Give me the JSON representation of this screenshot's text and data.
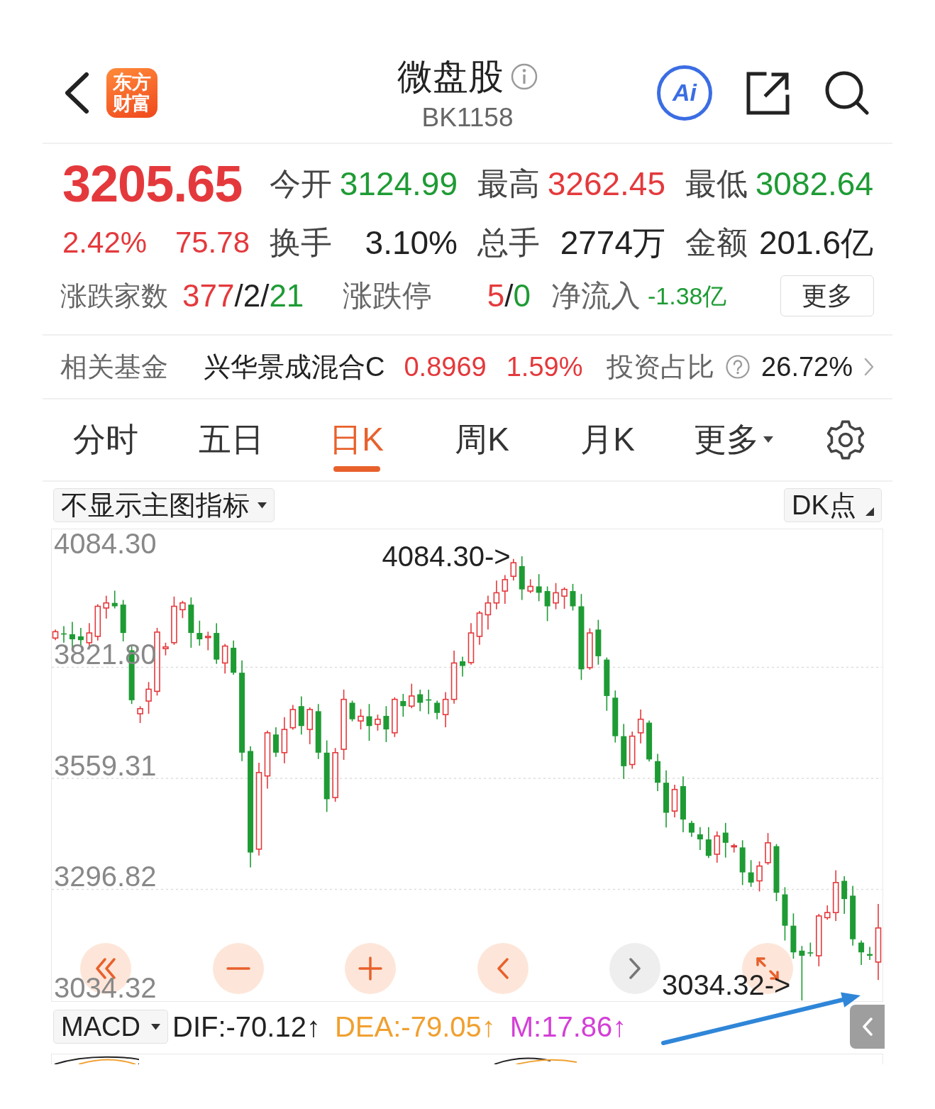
{
  "header": {
    "logo": [
      "东方",
      "财富"
    ],
    "title": "微盘股",
    "code": "BK1158",
    "ai_label": "Ai"
  },
  "quote": {
    "price": "3205.65",
    "change_percent": "2.42%",
    "change": "75.78",
    "rising": true,
    "stats": [
      {
        "label": "今开",
        "value": "3124.99",
        "color": "#1e9b34"
      },
      {
        "label": "最高",
        "value": "3262.45",
        "color": "#e4393c"
      },
      {
        "label": "最低",
        "value": "3082.64",
        "color": "#1e9b34"
      },
      {
        "label": "换手",
        "value": "3.10%",
        "color": "#222222"
      },
      {
        "label": "总手",
        "value": "2774万",
        "color": "#222222"
      },
      {
        "label": "金额",
        "value": "201.6亿",
        "color": "#222222"
      }
    ],
    "advance_decline": {
      "label": "涨跌家数",
      "parts": [
        {
          "text": "377",
          "color": "#e4393c"
        },
        {
          "text": "/",
          "color": "#222222"
        },
        {
          "text": "2",
          "color": "#222222"
        },
        {
          "text": "/",
          "color": "#222222"
        },
        {
          "text": "21",
          "color": "#1e9b34"
        }
      ]
    },
    "limit_up_down": {
      "label": "涨跌停",
      "parts": [
        {
          "text": "5",
          "color": "#e4393c"
        },
        {
          "text": "/",
          "color": "#222222"
        },
        {
          "text": "0",
          "color": "#1e9b34"
        }
      ]
    },
    "net_inflow": {
      "label": "净流入",
      "value": "-1.38亿",
      "rising": false
    },
    "more_button": "更多"
  },
  "related_fund": {
    "label": "相关基金",
    "name": "兴华景成混合C",
    "nav": "0.8969",
    "change": "1.59%",
    "rising": true,
    "ratio_label": "投资占比",
    "ratio": "26.72%"
  },
  "tabs": [
    {
      "label": "分时",
      "selected": false,
      "kind": "plain"
    },
    {
      "label": "五日",
      "selected": false,
      "kind": "plain"
    },
    {
      "label": "日K",
      "selected": true,
      "kind": "plain"
    },
    {
      "label": "周K",
      "selected": false,
      "kind": "plain"
    },
    {
      "label": "月K",
      "selected": false,
      "kind": "plain"
    },
    {
      "label": "更多",
      "selected": false,
      "kind": "menu"
    }
  ],
  "chart": {
    "indicator_select": "不显示主图指标",
    "dk_button": "DK点",
    "chart_data": {
      "type": "candlestick",
      "ylim": [
        3034.32,
        4148
      ],
      "grid": true,
      "yticks": [
        {
          "value": 4084.3,
          "label": "4084.30"
        },
        {
          "value": 3821.8,
          "label": "3821.80"
        },
        {
          "value": 3559.31,
          "label": "3559.31"
        },
        {
          "value": 3296.82,
          "label": "3296.82"
        },
        {
          "value": 3034.32,
          "label": "3034.32"
        }
      ],
      "ohlc": [
        [
          3891,
          3911,
          3886,
          3906
        ],
        [
          3902,
          3919,
          3880,
          3900
        ],
        [
          3900,
          3929,
          3866,
          3888
        ],
        [
          3895,
          3915,
          3872,
          3886
        ],
        [
          3880,
          3926,
          3868,
          3903
        ],
        [
          3895,
          3971,
          3885,
          3966
        ],
        [
          3962,
          3991,
          3937,
          3974
        ],
        [
          3974,
          4003,
          3961,
          3966
        ],
        [
          3970,
          3981,
          3883,
          3903
        ],
        [
          3862,
          3875,
          3735,
          3744
        ],
        [
          3712,
          3730,
          3690,
          3724
        ],
        [
          3742,
          3787,
          3712,
          3770
        ],
        [
          3765,
          3915,
          3755,
          3905
        ],
        [
          3866,
          3880,
          3850,
          3870
        ],
        [
          3880,
          3989,
          3875,
          3966
        ],
        [
          3958,
          3979,
          3938,
          3974
        ],
        [
          3970,
          3987,
          3868,
          3903
        ],
        [
          3903,
          3932,
          3873,
          3888
        ],
        [
          3892,
          3906,
          3862,
          3895
        ],
        [
          3903,
          3926,
          3830,
          3840
        ],
        [
          3832,
          3877,
          3807,
          3872
        ],
        [
          3868,
          3885,
          3804,
          3809
        ],
        [
          3809,
          3838,
          3600,
          3620
        ],
        [
          3624,
          3635,
          3349,
          3384
        ],
        [
          3392,
          3596,
          3377,
          3573
        ],
        [
          3565,
          3672,
          3535,
          3667
        ],
        [
          3663,
          3680,
          3610,
          3620
        ],
        [
          3620,
          3704,
          3595,
          3675
        ],
        [
          3679,
          3733,
          3674,
          3722
        ],
        [
          3730,
          3753,
          3663,
          3683
        ],
        [
          3675,
          3727,
          3640,
          3722
        ],
        [
          3718,
          3735,
          3605,
          3620
        ],
        [
          3620,
          3649,
          3480,
          3510
        ],
        [
          3514,
          3631,
          3504,
          3620
        ],
        [
          3628,
          3769,
          3603,
          3746
        ],
        [
          3738,
          3743,
          3694,
          3699
        ],
        [
          3695,
          3723,
          3675,
          3706
        ],
        [
          3706,
          3735,
          3648,
          3683
        ],
        [
          3687,
          3710,
          3672,
          3699
        ],
        [
          3707,
          3730,
          3645,
          3675
        ],
        [
          3667,
          3751,
          3657,
          3746
        ],
        [
          3742,
          3759,
          3705,
          3730
        ],
        [
          3730,
          3783,
          3725,
          3754
        ],
        [
          3758,
          3769,
          3718,
          3738
        ],
        [
          3746,
          3769,
          3711,
          3746
        ],
        [
          3738,
          3743,
          3699,
          3714
        ],
        [
          3710,
          3763,
          3680,
          3746
        ],
        [
          3746,
          3861,
          3736,
          3832
        ],
        [
          3836,
          3847,
          3800,
          3825
        ],
        [
          3833,
          3926,
          3828,
          3903
        ],
        [
          3895,
          3955,
          3875,
          3950
        ],
        [
          3946,
          3991,
          3911,
          3974
        ],
        [
          3974,
          4027,
          3959,
          3998
        ],
        [
          4002,
          4040,
          3972,
          4029
        ],
        [
          4037,
          4078,
          4027,
          4069
        ],
        [
          4061,
          4084.3,
          3981,
          4006
        ],
        [
          4002,
          4030,
          3997,
          4013
        ],
        [
          4013,
          4042,
          3978,
          3998
        ],
        [
          4002,
          4013,
          3931,
          3966
        ],
        [
          3974,
          4021,
          3959,
          3998
        ],
        [
          3990,
          4011,
          3960,
          4006
        ],
        [
          4002,
          4019,
          3956,
          3966
        ],
        [
          3966,
          3995,
          3792,
          3817
        ],
        [
          3821,
          3914,
          3816,
          3903
        ],
        [
          3911,
          3934,
          3828,
          3848
        ],
        [
          3840,
          3845,
          3719,
          3754
        ],
        [
          3750,
          3767,
          3644,
          3659
        ],
        [
          3659,
          3688,
          3558,
          3588
        ],
        [
          3592,
          3670,
          3582,
          3659
        ],
        [
          3667,
          3722,
          3642,
          3699
        ],
        [
          3691,
          3696,
          3599,
          3604
        ],
        [
          3600,
          3617,
          3529,
          3549
        ],
        [
          3549,
          3578,
          3443,
          3478
        ],
        [
          3482,
          3544,
          3467,
          3533
        ],
        [
          3541,
          3564,
          3432,
          3462
        ],
        [
          3454,
          3459,
          3421,
          3431
        ],
        [
          3427,
          3444,
          3390,
          3415
        ],
        [
          3415,
          3444,
          3371,
          3376
        ],
        [
          3380,
          3434,
          3360,
          3423
        ],
        [
          3431,
          3454,
          3372,
          3407
        ],
        [
          3399,
          3405,
          3384,
          3400
        ],
        [
          3396,
          3413,
          3307,
          3337
        ],
        [
          3337,
          3366,
          3303,
          3313
        ],
        [
          3317,
          3363,
          3292,
          3352
        ],
        [
          3360,
          3430,
          3355,
          3407
        ],
        [
          3399,
          3404,
          3269,
          3289
        ],
        [
          3285,
          3302,
          3176,
          3211
        ],
        [
          3211,
          3240,
          3133,
          3148
        ],
        [
          3152,
          3163,
          3034.32,
          3140
        ],
        [
          3148,
          3171,
          3138,
          3148
        ],
        [
          3140,
          3239,
          3115,
          3234
        ],
        [
          3230,
          3259,
          3225,
          3242
        ],
        [
          3242,
          3342,
          3222,
          3313
        ],
        [
          3317,
          3328,
          3239,
          3274
        ],
        [
          3282,
          3305,
          3164,
          3179
        ],
        [
          3171,
          3176,
          3118,
          3148
        ],
        [
          3144,
          3161,
          3130,
          3140
        ],
        [
          3124.99,
          3262.45,
          3082.64,
          3205.65
        ]
      ],
      "annotations": [
        "4084.30->",
        "3034.32->"
      ]
    },
    "controls": [
      {
        "kind": "rewind",
        "disabled": false
      },
      {
        "kind": "zoom-out",
        "disabled": false
      },
      {
        "kind": "zoom-in",
        "disabled": false
      },
      {
        "kind": "previous",
        "disabled": false
      },
      {
        "kind": "next",
        "disabled": true
      },
      {
        "kind": "expand",
        "disabled": false
      }
    ]
  },
  "macd": {
    "select": "MACD",
    "readouts": [
      {
        "text": "DIF:-70.12↑",
        "color": "#222222"
      },
      {
        "text": "DEA:-79.05↑",
        "color": "#f0a030"
      },
      {
        "text": "M:17.86↑",
        "color": "#d33fd6"
      }
    ]
  }
}
